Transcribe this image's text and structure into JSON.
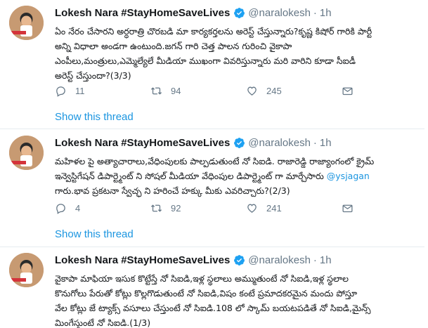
{
  "tweets": [
    {
      "name": "Lokesh Nara #StayHomeSaveLives",
      "handle": "@naralokesh",
      "dot": "·",
      "time": "1h",
      "avatar_label": "#StayHomeSaveLives",
      "lines": [
        "ఏం నేరం చేసారని అర్ధరాత్రి చొరబడి మా కార్యకర్తలను అరెస్ట్ చేస్తున్నారు?కృష్ణ కిషోర్ గారికి పార్టీ",
        "అన్ని విధాలా అండగా ఉంటుంది.జగన్ గారి చెత్త పాలన గురించి వైకాపా",
        "ఎంపీలు,మంత్రులు,ఎమ్మెల్యేలే మీడియా ముఖంగా వివరిస్తున్నారు మరి వారిని కూడా సీఐడీ",
        "అరెస్ట్ చేస్తుందా?(3/3)"
      ],
      "replies": "11",
      "retweets": "94",
      "likes": "245",
      "show_thread": "Show this thread"
    },
    {
      "name": "Lokesh Nara #StayHomeSaveLives",
      "handle": "@naralokesh",
      "dot": "·",
      "time": "1h",
      "avatar_label": "#StayHomeSaveLives",
      "lines": [
        "మహిళల పై అత్యాచారాలు,వేధింపులకు పాల్పడుతుంటే నో సిఐడి. రాజారెడ్డి రాజ్యాంగంలో క్రైమ్",
        "ఇన్వెస్టిగేషన్ డిపార్ట్మెంట్ ని సోషల్ మీడియా వేధింపుల డిపార్ట్మెంట్ గా మార్చేసారు ",
        "గారు.భావ ప్రకటనా స్వేచ్ఛ ని హరించే హక్కు మీకు ఎవరిచ్చారు?(2/3)"
      ],
      "mention": "@ysjagan",
      "replies": "4",
      "retweets": "92",
      "likes": "241",
      "show_thread": "Show this thread"
    },
    {
      "name": "Lokesh Nara #StayHomeSaveLives",
      "handle": "@naralokesh",
      "dot": "·",
      "time": "1h",
      "avatar_label": "#StayHomeSaveLives",
      "lines": [
        "వైకాపా మాఫియా ఇసుక కొట్టేస్తే నో సిఐడి,ఇళ్ల స్థలాలు అమ్ముతుంటే నో సిఐడి,ఇళ్ల స్థలాల",
        "కొనుగోలు పేరుతో కోట్లు కొల్లగొడుతుంటే నో సిఐడి,విషం కంటే ప్రమాదకరమైన మందు పోస్తూ",
        "వేల కోట్లు జే ట్యాక్స్ వసూలు చేస్తుంటే నో సిఐడి.108 లో స్కామ్ బయటపడితే నో సిఐడి,మైన్స్",
        "మింగేస్తుంటే నో సిఐడి.(1/3)"
      ]
    }
  ],
  "colors": {
    "link": "#1b95e0",
    "muted": "#657786",
    "verified": "#1da1f2",
    "text": "#14171a"
  }
}
